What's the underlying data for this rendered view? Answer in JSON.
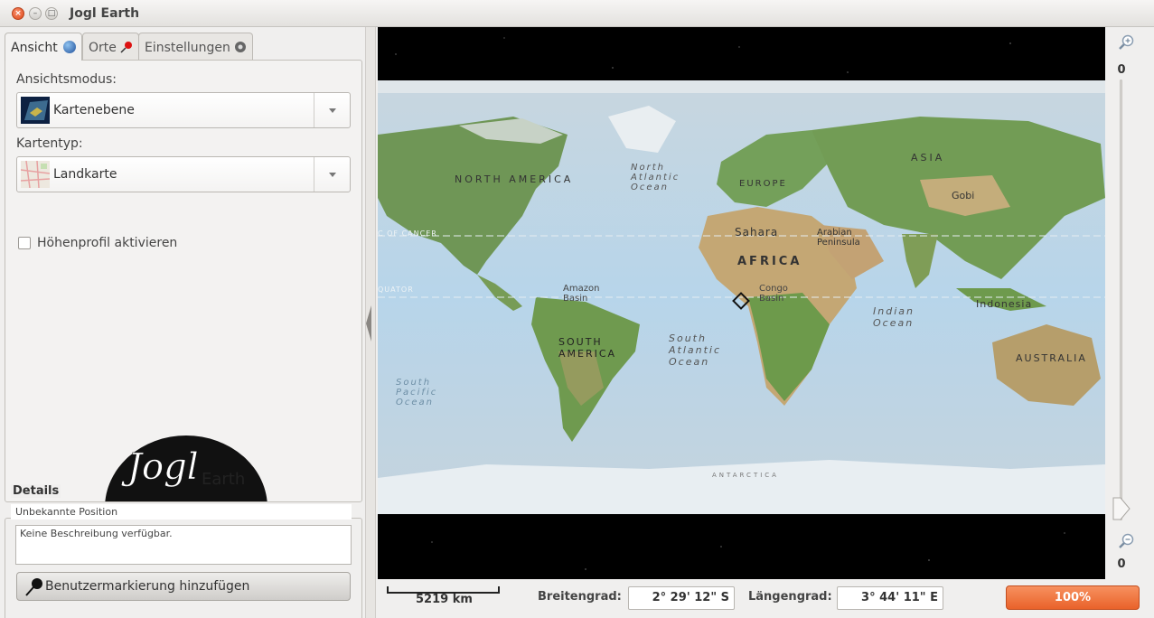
{
  "window": {
    "title": "Jogl Earth"
  },
  "tabs": [
    {
      "label": "Ansicht",
      "icon": "globe-icon",
      "active": true
    },
    {
      "label": "Orte",
      "icon": "pin-icon",
      "active": false
    },
    {
      "label": "Einstellungen",
      "icon": "gear-icon",
      "active": false
    }
  ],
  "view": {
    "mode_label": "Ansichtsmodus:",
    "mode_value": "Kartenebene",
    "maptype_label": "Kartentyp:",
    "maptype_value": "Landkarte",
    "elevation_label": "Höhenprofil aktivieren",
    "elevation_checked": false
  },
  "logo": {
    "text_main": "Jogl",
    "text_sub": "Earth"
  },
  "details": {
    "title": "Details",
    "position": "Unbekannte Position",
    "description": "Keine Beschreibung verfügbar.",
    "add_marker_label": "Benutzermarkierung hinzufügen"
  },
  "map": {
    "labels": {
      "north_america": "NORTH AMERICA",
      "south_america": "SOUTH AMERICA",
      "europe": "EUROPE",
      "asia": "ASIA",
      "africa": "AFRICA",
      "australia": "AUSTRALIA",
      "indonesia": "Indonesia",
      "sahara": "Sahara",
      "arabian": "Arabian Peninsula",
      "gobi": "Gobi",
      "amazon": "Amazon Basin",
      "congo": "Congo Basin",
      "north_atlantic": "North Atlantic Ocean",
      "south_atlantic": "South Atlantic Ocean",
      "south_pacific": "South Pacific Ocean",
      "indian": "Indian Ocean",
      "antarctica": "ANTARCTICA",
      "tropic_cancer": "C OF CANCER",
      "equator": "QUATOR"
    }
  },
  "zoom": {
    "top_value": "0",
    "bottom_value": "0"
  },
  "status": {
    "scale_label": "5219 km",
    "lat_label": "Breitengrad:",
    "lat_value": "2° 29' 12\" S",
    "lon_label": "Längengrad:",
    "lon_value": "3° 44' 11\" E",
    "progress_label": "100%",
    "progress_value": 100
  },
  "colors": {
    "accent": "#e9622a",
    "ocean": "#a9c6dc",
    "land": "#6f9a55"
  }
}
